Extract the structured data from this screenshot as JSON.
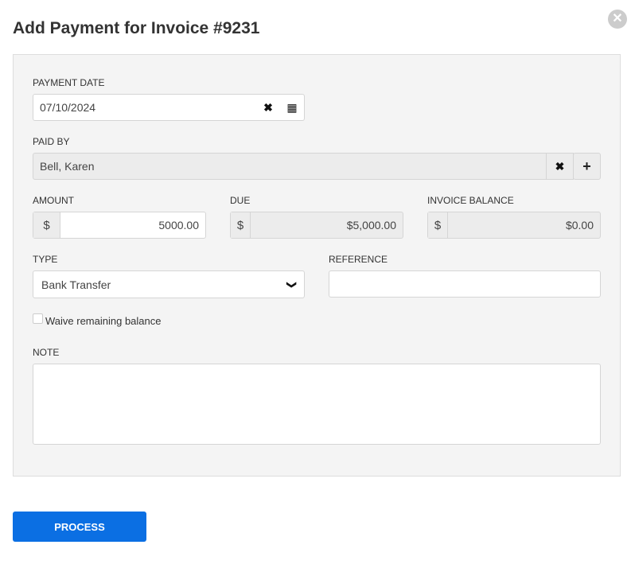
{
  "title": "Add Payment for Invoice #9231",
  "payment_date": {
    "label": "PAYMENT DATE",
    "value": "07/10/2024"
  },
  "paid_by": {
    "label": "PAID BY",
    "value": "Bell, Karen"
  },
  "amount": {
    "label": "AMOUNT",
    "currency": "$",
    "value": "5000.00"
  },
  "due": {
    "label": "DUE",
    "currency": "$",
    "value": "$5,000.00"
  },
  "balance": {
    "label": "INVOICE BALANCE",
    "currency": "$",
    "value": "$0.00"
  },
  "type": {
    "label": "TYPE",
    "value": "Bank Transfer"
  },
  "reference": {
    "label": "REFERENCE",
    "value": ""
  },
  "waive": {
    "label": "Waive remaining balance",
    "checked": false
  },
  "note": {
    "label": "NOTE",
    "value": ""
  },
  "process_label": "PROCESS",
  "accent": "#0b6fe3"
}
